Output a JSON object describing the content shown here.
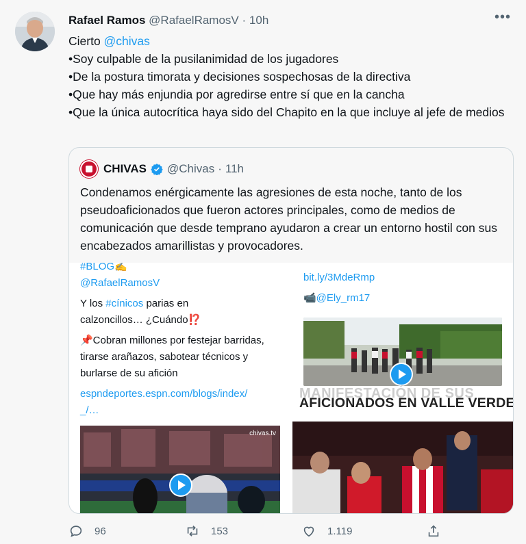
{
  "tweet": {
    "author_name": "Rafael Ramos",
    "author_handle": "@RafaelRamosV",
    "separator": "·",
    "time": "10h",
    "more": "•••",
    "line1_text": "Cierto ",
    "line1_mention": "@chivas",
    "lines": [
      "•Soy culpable de la pusilanimidad de los jugadores",
      "•De la postura timorata y decisiones sospechosas de la directiva",
      "•Que hay más enjundia por agredirse entre sí que en la cancha",
      "•Que la única autocrítica haya sido del Chapito en la que incluye al jefe de medios"
    ]
  },
  "quote": {
    "name": "CHIVAS",
    "handle": "@Chivas",
    "separator": "·",
    "time": "11h",
    "text": "Condenamos enérgicamente las agresiones de esta noche, tanto de los pseudoaficionados que fueron actores principales, como de medios de comunicación que desde temprano ayudaron a crear un entorno hostil con sus encabezados amarillistas y provocadores."
  },
  "media": {
    "left_card": {
      "tag": "#BLOG✍️",
      "handle": "@RafaelRamosV",
      "line_a_pre": "Y los ",
      "line_a_tag": "#cínicos",
      "line_a_post": " parias en",
      "line_b": "calzoncillos… ¿Cuándo⁉️",
      "para": "📌Cobran millones por festejar barridas, tirarse arañazos, sabotear técnicos y burlarse de su afición",
      "link1": "espndeportes.espn.com/blogs/index/",
      "link2": "_/…"
    },
    "right_card": {
      "link": "bit.ly/3MdeRmp",
      "credit": "📹@Ely_rm17",
      "banner_cut": "MANIFESTACIÓN DE SUS",
      "banner": "AFICIONADOS EN VALLE VERDE"
    },
    "watermark": "chivas.tv"
  },
  "actions": {
    "replies": "96",
    "retweets": "153",
    "likes": "1.119"
  },
  "colors": {
    "accent": "#1d9bf0",
    "muted": "#536471",
    "chivas_red": "#c8102e"
  }
}
